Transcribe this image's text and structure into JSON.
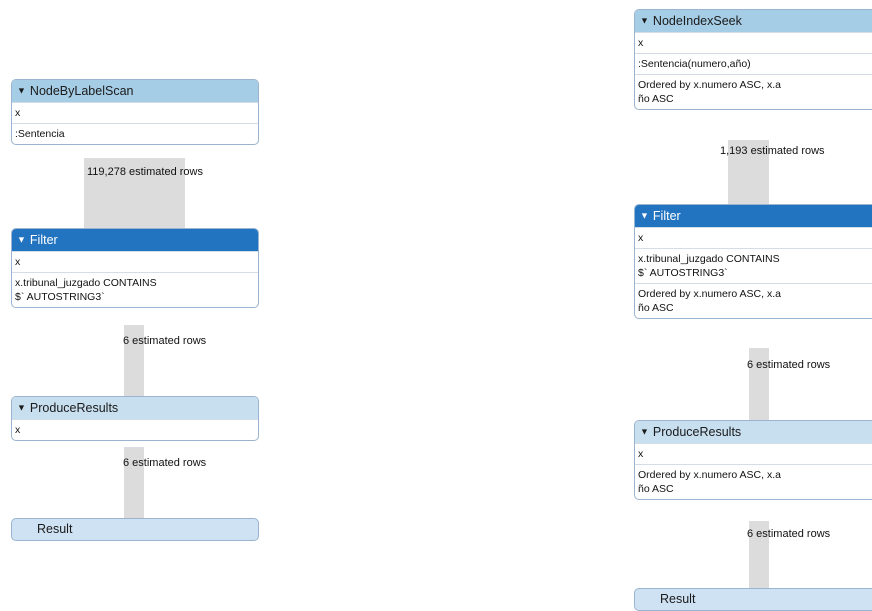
{
  "left_plan": {
    "node_by_label_scan": {
      "title": "NodeByLabelScan",
      "rows": [
        "x",
        ":Sentencia"
      ],
      "estimate": "119,278 estimated rows"
    },
    "filter": {
      "title": "Filter",
      "rows": [
        "x",
        "x.tribunal_juzgado CONTAINS\n$` AUTOSTRING3`"
      ],
      "estimate": "6 estimated rows"
    },
    "produce_results": {
      "title": "ProduceResults",
      "rows": [
        "x"
      ],
      "estimate": "6 estimated rows"
    },
    "result": {
      "title": "Result"
    }
  },
  "right_plan": {
    "node_index_seek": {
      "title": "NodeIndexSeek",
      "rows": [
        "x",
        ":Sentencia(numero,año)",
        "Ordered by x.numero ASC, x.a\nño ASC"
      ],
      "estimate": "1,193 estimated rows"
    },
    "filter": {
      "title": "Filter",
      "rows": [
        "x",
        "x.tribunal_juzgado CONTAINS\n$` AUTOSTRING3`",
        "Ordered by x.numero ASC, x.a\nño ASC"
      ],
      "estimate": "6 estimated rows"
    },
    "produce_results": {
      "title": "ProduceResults",
      "rows": [
        "x",
        "Ordered by x.numero ASC, x.a\nño ASC"
      ],
      "estimate": "6 estimated rows"
    },
    "result": {
      "title": "Result"
    }
  },
  "icons": {
    "collapse": "caret-down-icon"
  },
  "colors": {
    "header_light": "#a6cde6",
    "header_pale": "#c8dff0",
    "header_selected": "#2374c0",
    "border": "#9ab4cf",
    "connector": "#dcdcdc"
  }
}
